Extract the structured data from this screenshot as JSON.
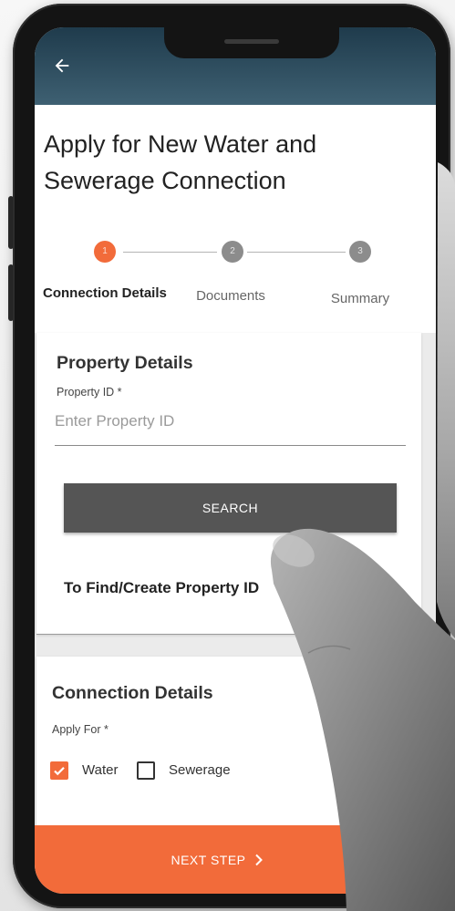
{
  "app_bar": {
    "back_icon": "back-arrow-icon"
  },
  "page": {
    "title": "Apply for New Water and Sewerage Connection"
  },
  "stepper": {
    "steps": [
      {
        "number": "1",
        "label": "Connection Details",
        "active": true
      },
      {
        "number": "2",
        "label": "Documents",
        "active": false
      },
      {
        "number": "3",
        "label": "Summary",
        "active": false
      }
    ]
  },
  "property_details": {
    "heading": "Property Details",
    "field_label": "Property ID *",
    "placeholder": "Enter Property ID",
    "value": "",
    "search_label": "SEARCH",
    "find_link": "To Find/Create Property ID"
  },
  "connection_details": {
    "heading": "Connection Details",
    "apply_for_label": "Apply For *",
    "check_icon": "check-icon",
    "options": [
      {
        "label": "Water",
        "checked": true
      },
      {
        "label": "Sewerage",
        "checked": false
      }
    ]
  },
  "footer": {
    "next_label": "NEXT STEP",
    "next_icon": "chevron-right-icon"
  },
  "colors": {
    "accent": "#f26b3a",
    "app_bar_top": "#1f3b4c",
    "app_bar_bottom": "#3e6072",
    "button": "#555555",
    "step_pending": "#8c8c8c"
  }
}
